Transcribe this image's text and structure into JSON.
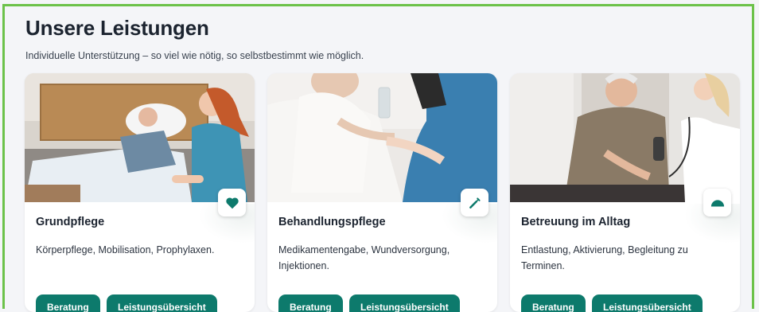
{
  "section": {
    "title": "Unsere Leistungen",
    "subtitle": "Individuelle Unterstützung – so viel wie nötig, so selbstbestimmt wie möglich."
  },
  "cards": [
    {
      "title": "Grundpflege",
      "description": "Körperpflege, Mobilisation, Prophylaxen.",
      "icon": "heart-icon",
      "button_primary": "Beratung",
      "button_secondary": "Leistungsübersicht"
    },
    {
      "title": "Behandlungspflege",
      "description": "Medikamentengabe, Wundversorgung, Injektionen.",
      "icon": "syringe-icon",
      "button_primary": "Beratung",
      "button_secondary": "Leistungsübersicht"
    },
    {
      "title": "Betreuung im Alltag",
      "description": "Entlastung, Aktivierung, Begleitung zu Terminen.",
      "icon": "half-circle-icon",
      "button_primary": "Beratung",
      "button_secondary": "Leistungsübersicht"
    }
  ],
  "colors": {
    "accent": "#0d7a6c",
    "frame": "#6cc24a",
    "background": "#f4f5f8",
    "text": "#1c2430"
  }
}
